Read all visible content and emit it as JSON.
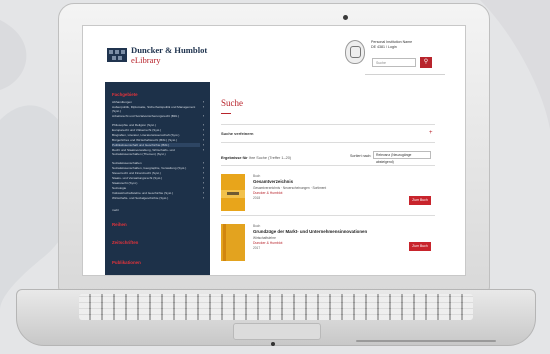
{
  "header": {
    "brand_line1": "Duncker & Humblot",
    "brand_line2": "eLibrary",
    "institution_lines": [
      "Personal Institution Name",
      "DE 4381 / Login"
    ],
    "search_placeholder": "Suche",
    "search_icon": "search-icon"
  },
  "sidebar": {
    "heading": "Fachgebiete",
    "items": [
      "Abhandlungen",
      "Außenpolitik, Diplomatie, Sicherheitspolitik und Management (Syst.)",
      "Arbeitsrecht und Sozialversicherungsrecht (Bibl.)",
      "Philosophie und Religion (Syst.)",
      "Europarecht und Völkerrecht (Syst.)",
      "Biografien, Literatur, Literaturwissenschaft (Syst.)",
      "Bürgerliches und Wirtschaftsrecht (Bibl.) (Syst.)",
      "Politikwissenschaft und Geschichte (Bibl.)",
      "Recht und Staatsverwaltung, Wirtschafts- und Sozialwissenschaften (Themen) (Syst.)",
      "Sozialwissenschaften",
      "Sozialwissenschaften, Geographie, Verwaltung (Syst.)",
      "Steuerrecht und Finanzrecht (Syst.)",
      "Staats- und Verwaltungsrecht (Syst.)",
      "Staatsrecht (Syst.)",
      "Soziologie",
      "Volkswirtschaftslehre und Geschichte (Syst.)",
      "Wirtschafts- und Sozialgeschichte (Syst.)"
    ],
    "more_link": "mehr",
    "heading2": "Reihen",
    "heading3": "Zeitschriften",
    "heading4": "Publikationen"
  },
  "main": {
    "title": "Suche",
    "refine_label": "Suche verfeinern",
    "results_label": "Ergebnisse für",
    "results_detail": "Ihre Suche (Treffer 1–20)",
    "sort_label": "Sortiert nach:",
    "sort_value": "Relevanz (Neuzugänge absteigend)",
    "results": [
      {
        "type": "Buch",
        "title": "Gesamtverzeichnis",
        "subtitle": "Gesamtverzeichnis · Neuerscheinungen · Sortiment",
        "author": "Duncker & Humblot",
        "year": "2018",
        "button": "Zum Buch"
      },
      {
        "type": "Buch",
        "title": "Grundzüge der Markt- und Unternehmensinnovationen",
        "subtitle": "Wirtschaftslehre",
        "author": "Duncker & Humblot",
        "year": "2017",
        "button": "Zum Buch"
      }
    ]
  },
  "colors": {
    "navy": "#1d3149",
    "accent_red": "#b8242c",
    "cover_orange": "#e8a51b"
  }
}
